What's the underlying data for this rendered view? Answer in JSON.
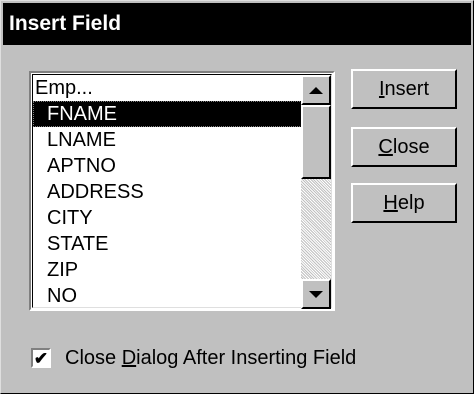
{
  "dialog": {
    "title": "Insert Field"
  },
  "field_list": {
    "items": [
      {
        "label": "Emp...",
        "selected": false,
        "child": false
      },
      {
        "label": "FNAME",
        "selected": true,
        "child": true
      },
      {
        "label": "LNAME",
        "selected": false,
        "child": true
      },
      {
        "label": "APTNO",
        "selected": false,
        "child": true
      },
      {
        "label": "ADDRESS",
        "selected": false,
        "child": true
      },
      {
        "label": "CITY",
        "selected": false,
        "child": true
      },
      {
        "label": "STATE",
        "selected": false,
        "child": true
      },
      {
        "label": "ZIP",
        "selected": false,
        "child": true
      },
      {
        "label": "NO",
        "selected": false,
        "child": true
      }
    ]
  },
  "buttons": {
    "insert": {
      "mnemonic": "I",
      "rest": "nsert"
    },
    "close": {
      "mnemonic": "C",
      "rest": "lose"
    },
    "help": {
      "mnemonic": "H",
      "rest": "elp"
    }
  },
  "close_after_insert": {
    "checked": true,
    "check_glyph": "✔",
    "label_before": "Close ",
    "label_mnemonic": "D",
    "label_after": "ialog After Inserting Field"
  }
}
